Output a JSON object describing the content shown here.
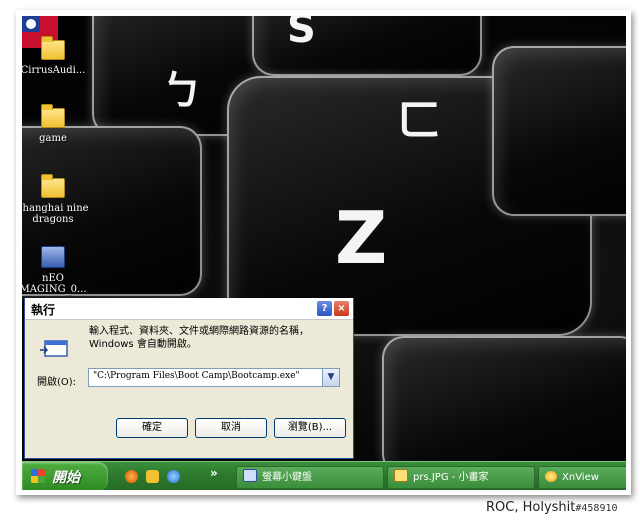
{
  "desktop": {
    "icons": [
      {
        "label": "CirrusAudi...",
        "type": "folder"
      },
      {
        "label": "game",
        "type": "folder"
      },
      {
        "label": "shanghai nine dragons",
        "type": "folder"
      },
      {
        "label": "nEO MAGING_0...",
        "type": "app"
      }
    ],
    "wallpaper_legends": [
      "ㄅ",
      "ㄈ",
      "Z",
      "S"
    ]
  },
  "run_dialog": {
    "title": "執行",
    "description": "輸入程式、資料夾、文件或網際網路資源的名稱，Windows 會自動開啟。",
    "open_label": "開啟(O):",
    "open_value": "\"C:\\Program Files\\Boot Camp\\Bootcamp.exe\"",
    "buttons": {
      "ok": "確定",
      "cancel": "取消",
      "browse": "瀏覽(B)..."
    },
    "title_buttons": {
      "help": "?",
      "close": "×"
    }
  },
  "taskbar": {
    "start_label": "開始",
    "overflow": "»",
    "tasks": [
      {
        "label": "螢幕小鍵盤"
      },
      {
        "label": "prs.JPG - 小畫家"
      },
      {
        "label": "XnView"
      }
    ]
  },
  "watermark": {
    "text": "ROC, Holyshit",
    "id": "#458910"
  },
  "colors": {
    "taskbar": "#2f7a2f",
    "dialog_bg": "#ece9d8",
    "title_border": "#2b4f9e"
  }
}
